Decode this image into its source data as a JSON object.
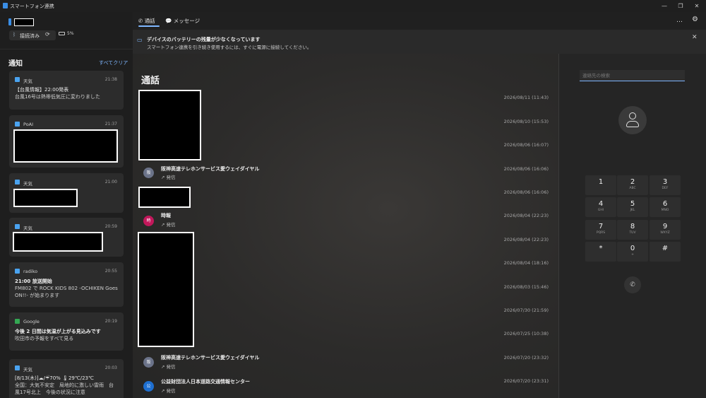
{
  "window": {
    "title": "スマートフォン連携",
    "minimize": "—",
    "restore": "❐",
    "close": "✕"
  },
  "sidebar": {
    "connection": "接続済み",
    "battery": "5%",
    "section_title": "通知",
    "clear_all": "すべてクリア",
    "cards": [
      {
        "app": "天気",
        "time": "21:38",
        "line1": "【台風情報】22:00発表",
        "line2": "台風16号は熱帯低気圧に変わりました"
      },
      {
        "app": "PoAI",
        "time": "21:37"
      },
      {
        "app": "天気",
        "time": "21:00"
      },
      {
        "app": "天気",
        "time": "20:59"
      },
      {
        "app": "radiko",
        "time": "20:55",
        "line1": "21:00 放送開始",
        "line2": "FM802 で ROCK KIDS 802 -OCHIKEN Goes",
        "line3": "ON!!- が始まります"
      },
      {
        "app": "Google",
        "time": "20:19",
        "line1": "今後 2 日間は気温が上がる見込みです",
        "line2": "吹田市の予報をすべて見る"
      },
      {
        "app": "天気",
        "time": "20:03",
        "line1": "[8/13(木)]☁/☔70% 🌡29℃/23℃",
        "line2": "全国：大気不安定　局地的に激しい雷雨　台",
        "line3": "風17号北上　今後の状況に注意"
      }
    ]
  },
  "tabs": {
    "calls": "通話",
    "messages": "メッセージ",
    "more": "…",
    "settings": "⚙"
  },
  "banner": {
    "title": "デバイスのバッテリーの残量が少なくなっています",
    "subtitle": "スマートフォン連携を引き続き使用するには、すぐに電源に接続してください。",
    "close": "✕"
  },
  "calls": {
    "title": "通話",
    "outgoing_label": "発信",
    "dates": [
      "2026/08/11 (11:43)",
      "2026/08/10 (15:53)",
      "2026/08/06 (16:07)",
      "2026/08/06 (16:06)",
      "2026/08/06 (16:06)",
      "2026/08/04 (22:23)",
      "2026/08/04 (22:23)",
      "2026/08/04 (18:16)",
      "2026/08/03 (15:46)",
      "2026/07/30 (21:59)",
      "2026/07/25 (10:38)",
      "2026/07/20 (23:32)",
      "2026/07/20 (23:31)"
    ],
    "entries": [
      {
        "name": "阪神高速テレホンサービス愛ウェイダイヤル",
        "avatar": "阪",
        "color": "#6b7389"
      },
      {
        "name": "時報",
        "avatar": "時",
        "color": "#c2185b"
      },
      {
        "name": "阪神高速テレホンサービス愛ウェイダイヤル",
        "avatar": "阪",
        "color": "#6b7389"
      },
      {
        "name": "公益財団法人日本道路交通情報センター",
        "avatar": "公",
        "color": "#1e6fd0"
      }
    ]
  },
  "dialer": {
    "search_placeholder": "連絡先の検索",
    "keys": [
      {
        "d": "1",
        "l": ""
      },
      {
        "d": "2",
        "l": "ABC"
      },
      {
        "d": "3",
        "l": "DEF"
      },
      {
        "d": "4",
        "l": "GHI"
      },
      {
        "d": "5",
        "l": "JKL"
      },
      {
        "d": "6",
        "l": "MNO"
      },
      {
        "d": "7",
        "l": "PQRS"
      },
      {
        "d": "8",
        "l": "TUV"
      },
      {
        "d": "9",
        "l": "WXYZ"
      },
      {
        "d": "*",
        "l": ""
      },
      {
        "d": "0",
        "l": "+"
      },
      {
        "d": "#",
        "l": ""
      }
    ]
  }
}
